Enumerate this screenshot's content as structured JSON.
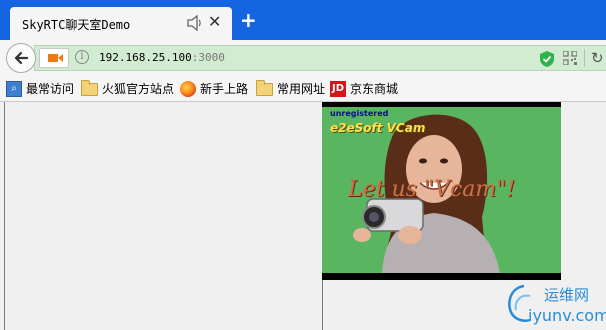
{
  "tab": {
    "title": "SkyRTC聊天室Demo",
    "audio_icon": "speaker-icon",
    "close_icon": "close-icon",
    "new_tab_label": "+"
  },
  "urlbar": {
    "host": "192.168.25.100",
    "port": ":3000",
    "site_icon": "camera-icon",
    "info_icon": "info-icon",
    "security_icon": "shield-icon",
    "qr_icon": "qr-code-icon",
    "reload_icon": "reload-icon"
  },
  "bookmarks": [
    {
      "label": "最常访问",
      "icon": "most-visited-icon"
    },
    {
      "label": "火狐官方站点",
      "icon": "folder-icon"
    },
    {
      "label": "新手上路",
      "icon": "firefox-icon"
    },
    {
      "label": "常用网址",
      "icon": "folder-icon"
    },
    {
      "label": "京东商城",
      "icon": "jd-icon",
      "icon_text": "JD"
    }
  ],
  "video": {
    "watermark_unregistered": "unregistered",
    "watermark_brand": "e2eSoft VCam",
    "caption": "Let us \"Vcam\"!"
  },
  "site_watermark": {
    "cn": "运维网",
    "en": "iyunv.com"
  },
  "colors": {
    "titlebar": "#1565e0",
    "urlbar_secure": "#d2ecd2",
    "video_bg": "#59b55f",
    "watermark": "#2a8cd8"
  }
}
